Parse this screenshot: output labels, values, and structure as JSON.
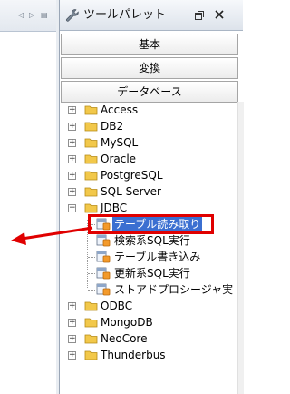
{
  "palette": {
    "title": "ツールパレット",
    "drawers": [
      "基本",
      "変換",
      "データベース"
    ]
  },
  "tree": {
    "categories": [
      {
        "label": "Access",
        "expanded": false
      },
      {
        "label": "DB2",
        "expanded": false
      },
      {
        "label": "MySQL",
        "expanded": false
      },
      {
        "label": "Oracle",
        "expanded": false
      },
      {
        "label": "PostgreSQL",
        "expanded": false
      },
      {
        "label": "SQL Server",
        "expanded": false
      },
      {
        "label": "JDBC",
        "expanded": true
      },
      {
        "label": "ODBC",
        "expanded": false
      },
      {
        "label": "MongoDB",
        "expanded": false
      },
      {
        "label": "NeoCore",
        "expanded": false
      },
      {
        "label": "Thunderbus",
        "expanded": false
      }
    ],
    "jdbc_tools": [
      {
        "label": "テーブル読み取り",
        "selected": true
      },
      {
        "label": "検索系SQL実行",
        "selected": false
      },
      {
        "label": "テーブル書き込み",
        "selected": false
      },
      {
        "label": "更新系SQL実行",
        "selected": false
      },
      {
        "label": "ストアドプロシージャ実",
        "selected": false
      }
    ]
  },
  "colors": {
    "selection": "#3b6fd1",
    "annotation": "#e00000",
    "folder": "#f2c84a"
  },
  "icons": {
    "view": "wrench-icon",
    "restore": "restore-window-icon",
    "close": "close-icon",
    "folder": "folder-icon",
    "tool": "db-tool-icon"
  }
}
